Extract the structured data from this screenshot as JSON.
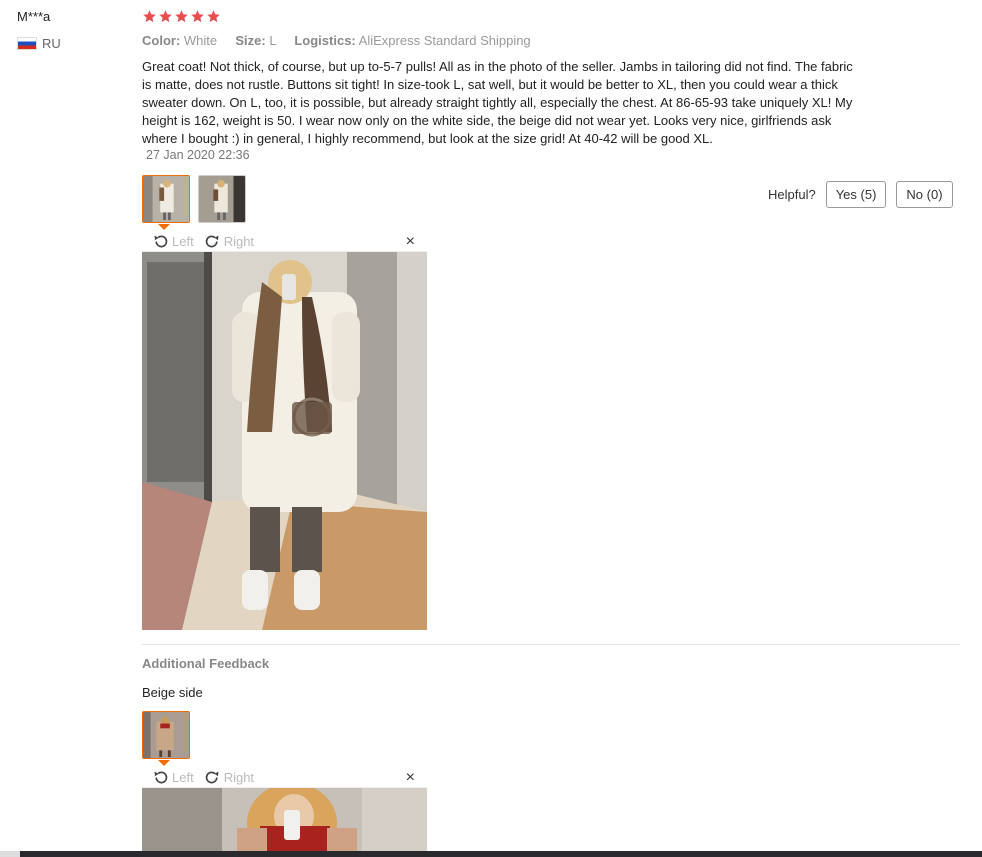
{
  "review": {
    "user": {
      "name": "M***a",
      "country": "RU"
    },
    "rating": 5,
    "meta": {
      "color_key": "Color:",
      "color_val": "White",
      "size_key": "Size:",
      "size_val": "L",
      "logistics_key": "Logistics:",
      "logistics_val": "AliExpress Standard Shipping"
    },
    "text": "Great coat! Not thick, of course, but up to-5-7 pulls! All as in the photo of the seller. Jambs in tailoring did not find. The fabric is matte, does not rustle. Buttons sit tight! In size-took L, sat well, but it would be better to XL, then you could wear a thick sweater down. On L, too, it is possible, but already straight tightly all, especially the chest. At 86-65-93 take uniquely XL! My height is 162, weight is 50. I wear now only on the white side, the beige did not wear yet. Looks very nice, girlfriends ask where I bought :) in general, I highly recommend, but look at the size grid! At 40-42 will be good XL.",
    "date": "27 Jan 2020 22:36"
  },
  "helpful": {
    "label": "Helpful?",
    "yes": "Yes (5)",
    "no": "No (0)"
  },
  "viewer": {
    "left": "Left",
    "right": "Right",
    "close": "×"
  },
  "additional": {
    "title": "Additional Feedback",
    "text": "Beige side"
  },
  "colors": {
    "star": "#e84c4c",
    "active_border": "#f26c06",
    "icon_gray": "#555"
  }
}
